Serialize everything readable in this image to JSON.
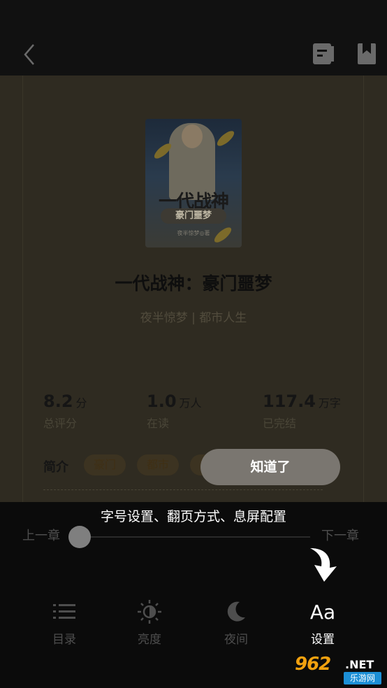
{
  "header": {
    "back_icon": "chevron-left-icon",
    "catalog_icon": "book-catalog-icon",
    "bookmark_icon": "bookmark-icon"
  },
  "book": {
    "cover_title": "一代战神",
    "cover_subtitle": "豪门噩梦",
    "cover_author": "夜半惊梦◎著",
    "title": "一代战神：豪门噩梦",
    "meta": "夜半惊梦 | 都市人生"
  },
  "stats": [
    {
      "value": "8.2",
      "unit": "分",
      "label": "总评分"
    },
    {
      "value": "1.0",
      "unit": "万人",
      "label": "在读"
    },
    {
      "value": "117.4",
      "unit": "万字",
      "label": "已完结"
    }
  ],
  "intro": {
    "label": "简介",
    "tags": [
      "豪门",
      "都市",
      "装逼"
    ]
  },
  "guide": {
    "got_it": "知道了",
    "hint": "字号设置、翻页方式、息屏配置"
  },
  "chapter_nav": {
    "prev": "上一章",
    "next": "下一章",
    "progress": 0
  },
  "bottom_nav": [
    {
      "label": "目录",
      "icon": "list-icon"
    },
    {
      "label": "亮度",
      "icon": "brightness-icon"
    },
    {
      "label": "夜间",
      "icon": "moon-icon"
    },
    {
      "label": "设置",
      "icon": "font-settings-icon",
      "glyph": "Aa"
    }
  ],
  "watermark": {
    "number": "962",
    "suffix": ".NET",
    "site": "乐游网"
  },
  "colors": {
    "overlay": "#0b0b0b",
    "content_dim": "#2f2b21",
    "watermark_orange": "#f1a10f",
    "watermark_blue": "#1c8fd6"
  }
}
